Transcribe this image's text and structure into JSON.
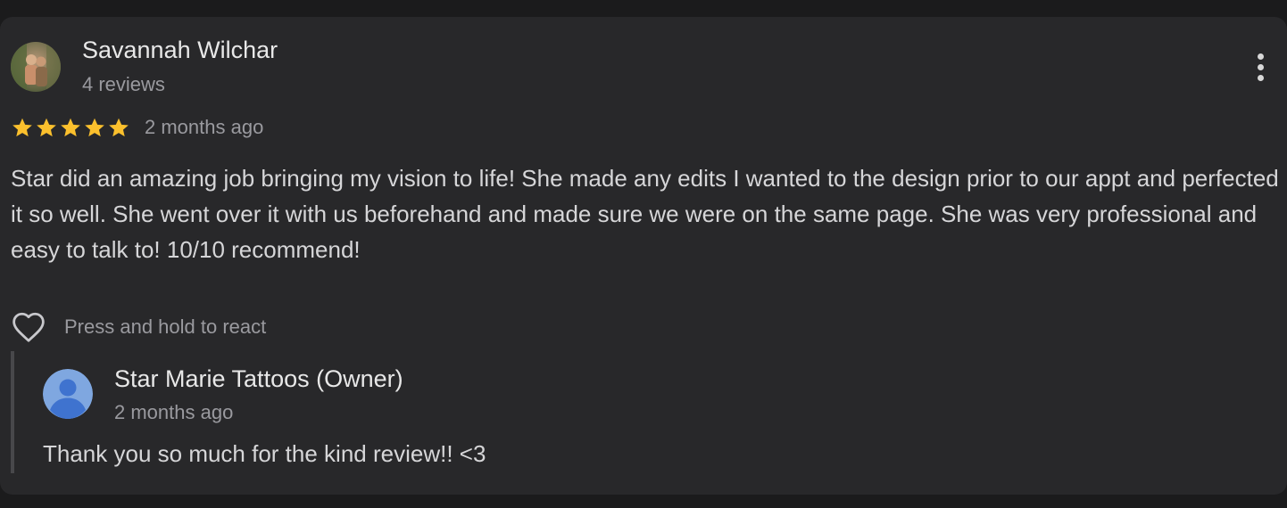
{
  "review": {
    "reviewer_name": "Savannah Wilchar",
    "review_count": "4 reviews",
    "rating": 5,
    "max_rating": 5,
    "time": "2 months ago",
    "text": "Star did an amazing job bringing my vision to life! She made any edits I wanted to the design prior to our appt and perfected it so well. She went over it with us beforehand and made sure we were on the same page. She was very professional and easy to talk to! 10/10 recommend!",
    "react_hint": "Press and hold to react"
  },
  "owner_reply": {
    "name": "Star Marie Tattoos (Owner)",
    "time": "2 months ago",
    "text": "Thank you so much for the kind review!! <3"
  },
  "icons": {
    "star": "star-icon",
    "more": "more-vert-icon",
    "heart": "heart-outline-icon",
    "owner_avatar": "default-person-avatar"
  },
  "colors": {
    "card_background": "#28282a",
    "page_background": "#1b1b1c",
    "star": "#fbc02d",
    "primary_text": "#e8e8e8",
    "secondary_text": "#9a9a9f",
    "owner_avatar": "#7fa7e0"
  }
}
